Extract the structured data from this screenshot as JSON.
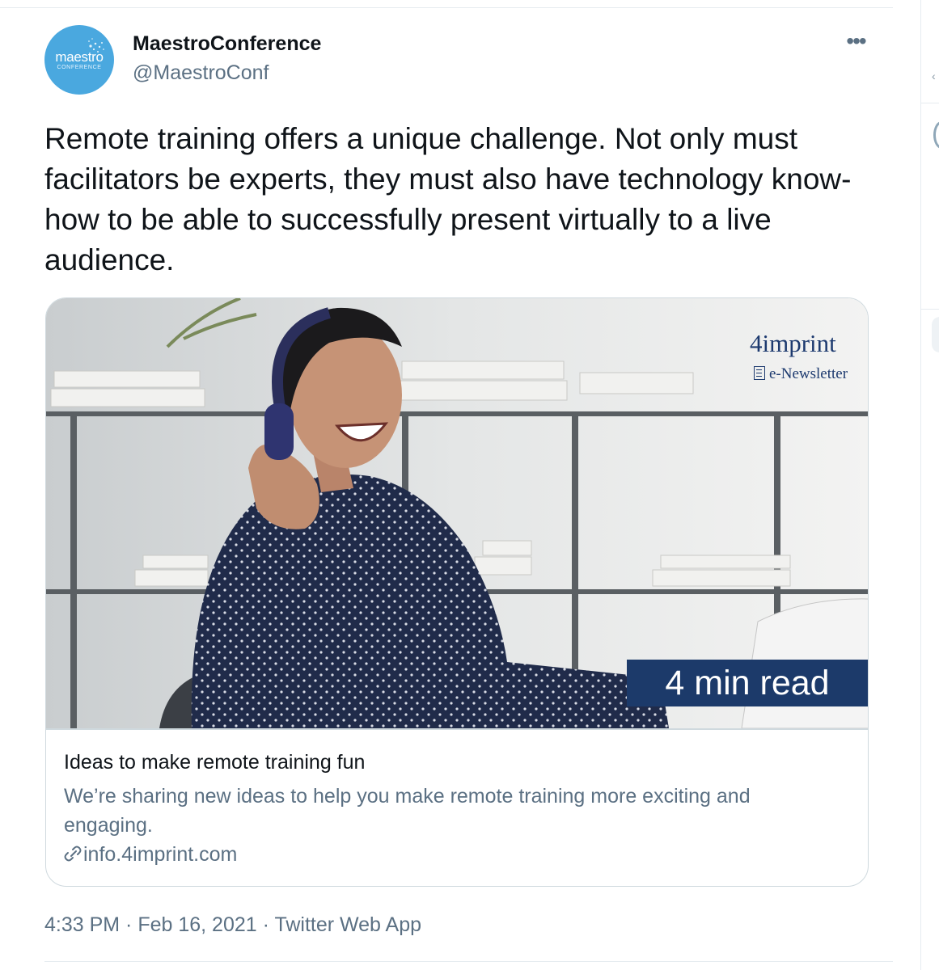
{
  "tweet": {
    "author": {
      "display_name": "MaestroConference",
      "handle": "@MaestroConf",
      "avatar_wordmark": "maestro",
      "avatar_submark": "CONFERENCE"
    },
    "more_label": "•••",
    "text": "Remote training offers a unique challenge. Not only must facilitators be experts, they must also have technology know-how to be able to successfully present virtually to a live audience.",
    "card": {
      "brand_logo": "4imprint",
      "brand_sub": "e-Newsletter",
      "read_time": "4 min read",
      "title": "Ideas to make remote training fun",
      "description": "We’re sharing new ideas to help you make remote training more exciting and engaging.",
      "domain": "info.4imprint.com"
    },
    "meta": {
      "time": "4:33 PM",
      "separator": " · ",
      "date": "Feb 16, 2021",
      "source": "Twitter Web App"
    }
  },
  "colors": {
    "text_primary": "#0f1419",
    "text_secondary": "#5b7083",
    "border": "#cfd9de",
    "avatar_bg": "#4aa8df",
    "badge_bg": "#1c3a6a"
  },
  "icons": [
    "more-icon",
    "link-icon",
    "newsletter-icon"
  ]
}
